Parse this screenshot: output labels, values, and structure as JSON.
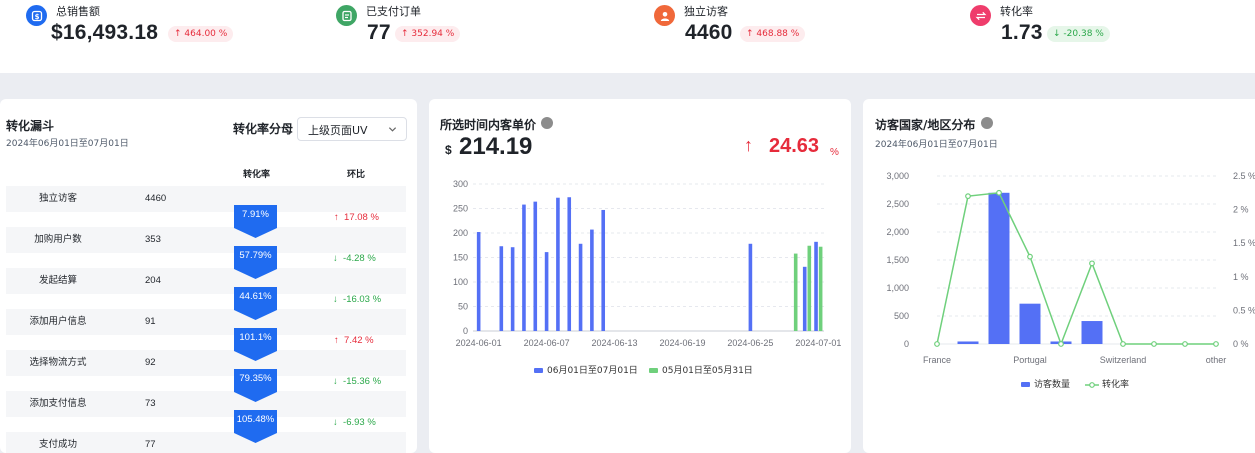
{
  "kpis": [
    {
      "label": "总销售额",
      "value": "$16,493.18",
      "change": "464.00 %",
      "direction": "up",
      "icon": "dollar-icon",
      "color": "#1f6bf0"
    },
    {
      "label": "已支付订单",
      "value": "77",
      "change": "352.94 %",
      "direction": "up",
      "icon": "order-icon",
      "color": "#3fa665"
    },
    {
      "label": "独立访客",
      "value": "4460",
      "change": "468.88 %",
      "direction": "up",
      "icon": "user-icon",
      "color": "#f0683a"
    },
    {
      "label": "转化率",
      "value": "1.73",
      "change": "-20.38 %",
      "direction": "down",
      "icon": "exchange-icon",
      "color": "#ef3d6c"
    }
  ],
  "funnel": {
    "title": "转化漏斗",
    "date_range": "2024年06月01日至07月01日",
    "selector_title": "转化率分母",
    "selector_value": "上级页面UV",
    "col_rate": "转化率",
    "col_ratio": "环比",
    "rows": [
      {
        "name": "独立访客",
        "value": "4460"
      },
      {
        "name": "加购用户数",
        "value": "353"
      },
      {
        "name": "发起结算",
        "value": "204"
      },
      {
        "name": "添加用户信息",
        "value": "91"
      },
      {
        "name": "选择物流方式",
        "value": "92"
      },
      {
        "name": "添加支付信息",
        "value": "73"
      },
      {
        "name": "支付成功",
        "value": "77"
      }
    ],
    "rates": [
      {
        "rate": "7.91%",
        "ratio": "17.08 %",
        "direction": "up"
      },
      {
        "rate": "57.79%",
        "ratio": "-4.28 %",
        "direction": "down"
      },
      {
        "rate": "44.61%",
        "ratio": "-16.03 %",
        "direction": "down"
      },
      {
        "rate": "101.1%",
        "ratio": "7.42 %",
        "direction": "up"
      },
      {
        "rate": "79.35%",
        "ratio": "-15.36 %",
        "direction": "down"
      },
      {
        "rate": "105.48%",
        "ratio": "-6.93 %",
        "direction": "down"
      }
    ],
    "colors": {
      "accent": "#1f6bf0",
      "up": "#e62b3b",
      "down": "#2ba84a"
    }
  },
  "price_card": {
    "title": "所选时间内客单价",
    "currency": "$",
    "value": "214.19",
    "change": "24.63",
    "change_unit": "%",
    "direction": "up"
  },
  "country_card": {
    "title": "访客国家/地区分布",
    "date_range": "2024年06月01日至07月01日"
  },
  "chart_data": [
    {
      "type": "bar",
      "x": [
        "2024-06-01",
        "2024-06-02",
        "2024-06-03",
        "2024-06-04",
        "2024-06-05",
        "2024-06-06",
        "2024-06-07",
        "2024-06-08",
        "2024-06-09",
        "2024-06-10",
        "2024-06-11",
        "2024-06-12",
        "2024-06-13",
        "2024-06-14",
        "2024-06-15",
        "2024-06-16",
        "2024-06-17",
        "2024-06-18",
        "2024-06-19",
        "2024-06-20",
        "2024-06-21",
        "2024-06-22",
        "2024-06-23",
        "2024-06-24",
        "2024-06-25",
        "2024-06-26",
        "2024-06-27",
        "2024-06-28",
        "2024-06-29",
        "2024-06-30",
        "2024-07-01"
      ],
      "x_tick_labels": [
        "2024-06-01",
        "2024-06-07",
        "2024-06-13",
        "2024-06-19",
        "2024-06-25",
        "2024-07-01"
      ],
      "series": [
        {
          "name": "06月01日至07月01日",
          "color": "#5470f5",
          "values": [
            202,
            0,
            173,
            171,
            258,
            264,
            161,
            272,
            273,
            178,
            207,
            247,
            0,
            0,
            0,
            0,
            0,
            0,
            0,
            0,
            0,
            0,
            0,
            0,
            178,
            0,
            0,
            0,
            0,
            131,
            182
          ]
        },
        {
          "name": "05月01日至05月31日",
          "color": "#6fd07c",
          "values": [
            0,
            0,
            0,
            0,
            0,
            0,
            0,
            0,
            0,
            0,
            0,
            0,
            0,
            0,
            0,
            0,
            0,
            0,
            0,
            0,
            0,
            0,
            0,
            0,
            0,
            0,
            0,
            0,
            158,
            174,
            172
          ]
        }
      ],
      "ylim": [
        0,
        300
      ],
      "y_ticks": [
        0,
        50,
        100,
        150,
        200,
        250,
        300
      ],
      "grid": true,
      "legend": "bottom"
    },
    {
      "type": "bar",
      "categories": [
        "France",
        "",
        "",
        "Portugal",
        "",
        "",
        "Switzerland",
        "",
        "",
        "other"
      ],
      "x_tick_labels": [
        "France",
        "Portugal",
        "Switzerland",
        "other"
      ],
      "series": [
        {
          "name": "访客数量",
          "type": "bar",
          "color": "#5470f5",
          "axis": "left",
          "values": [
            0,
            45,
            2700,
            720,
            45,
            410,
            0,
            0,
            0,
            0
          ]
        },
        {
          "name": "转化率",
          "type": "line",
          "color": "#6fd07c",
          "axis": "right",
          "values": [
            0.0,
            2.2,
            2.25,
            1.3,
            0.0,
            1.2,
            0.0,
            0.0,
            0.0,
            0.0
          ]
        }
      ],
      "ylim_left": [
        0,
        3000
      ],
      "y_ticks_left": [
        0,
        500,
        1000,
        1500,
        2000,
        2500,
        3000
      ],
      "y_tick_labels_left": [
        "0",
        "500",
        "1,000",
        "1,500",
        "2,000",
        "2,500",
        "3,000"
      ],
      "ylim_right": [
        0,
        2.5
      ],
      "y_ticks_right": [
        0,
        0.5,
        1,
        1.5,
        2,
        2.5
      ],
      "y_tick_labels_right": [
        "0 %",
        "0.5 %",
        "1 %",
        "1.5 %",
        "2 %",
        "2.5 %"
      ],
      "grid": true,
      "legend": "bottom"
    }
  ]
}
